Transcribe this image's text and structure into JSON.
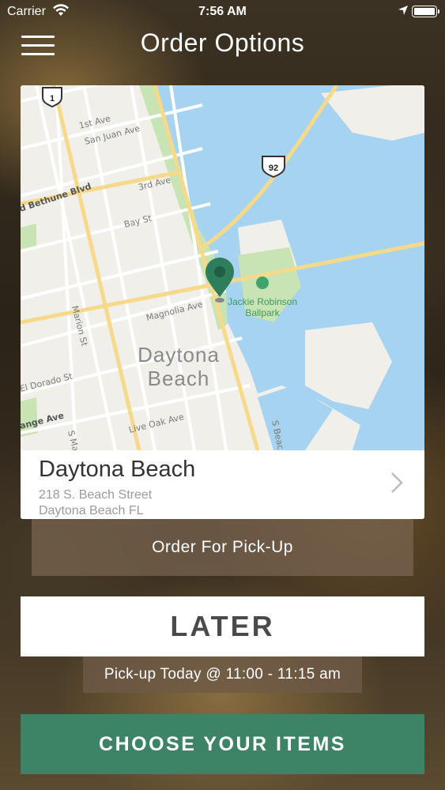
{
  "status_bar": {
    "carrier": "Carrier",
    "time": "7:56 AM"
  },
  "header": {
    "title": "Order Options",
    "menu_icon": "hamburger-menu-icon"
  },
  "map": {
    "city_label_line1": "Daytona",
    "city_label_line2": "Beach",
    "park_label_line1": "Jackie Robinson",
    "park_label_line2": "Ballpark",
    "highway_1": "1",
    "highway_92": "92",
    "streets": [
      "1st Ave",
      "San Juan Ave",
      "3rd Ave",
      "Bay St",
      "Magnolia Ave",
      "d Bethune Blvd",
      "Marion St",
      "El Dorado St",
      "ange Ave",
      "Live Oak Ave",
      "S Mar",
      "S Beac"
    ],
    "colors": {
      "water": "#a6d3ef",
      "land": "#f1efe9",
      "park": "#c8e4b4",
      "road": "#fbe6a2",
      "pin": "#2e7d5b"
    }
  },
  "location": {
    "name": "Daytona Beach",
    "address_line1": "218 S. Beach Street",
    "address_line2": "Daytona Beach FL"
  },
  "order_type_label": "Order For Pick-Up",
  "timing": {
    "selection": "LATER",
    "pickup_window": "Pick-up Today @ 11:00 - 11:15 am"
  },
  "cta": {
    "label": "CHOOSE YOUR ITEMS",
    "color": "#3d8467"
  }
}
